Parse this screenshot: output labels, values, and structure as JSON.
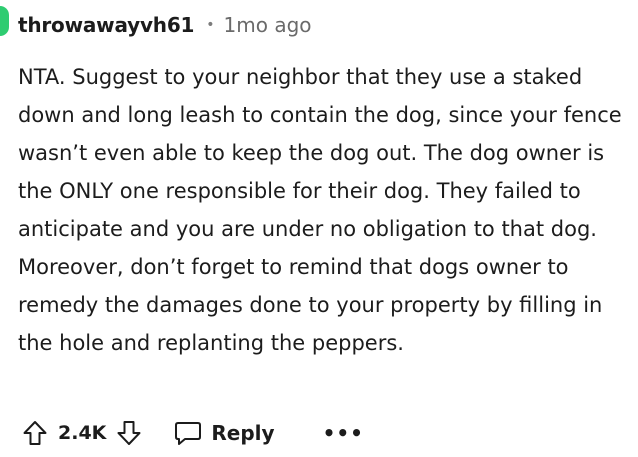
{
  "comment": {
    "author": "throwawayvh61",
    "separator": "•",
    "timestamp": "1mo ago",
    "body": "NTA. Suggest to your neighbor that they use a staked down and long leash to contain the dog, since your fence wasn’t even able to keep the dog out. The dog owner is the ONLY one responsible for their dog. They failed to anticipate and you are under no obligation to that dog. Moreover, don’t forget to remind that dogs owner to remedy the damages done to your property by filling in the hole and replanting the peppers.",
    "avatar_color": "#2ecc71"
  },
  "actions": {
    "upvote_icon": "arrow-up-outline-icon",
    "vote_count": "2.4K",
    "downvote_icon": "arrow-down-outline-icon",
    "reply_icon": "speech-bubble-icon",
    "reply_label": "Reply",
    "more_label": "•••"
  }
}
